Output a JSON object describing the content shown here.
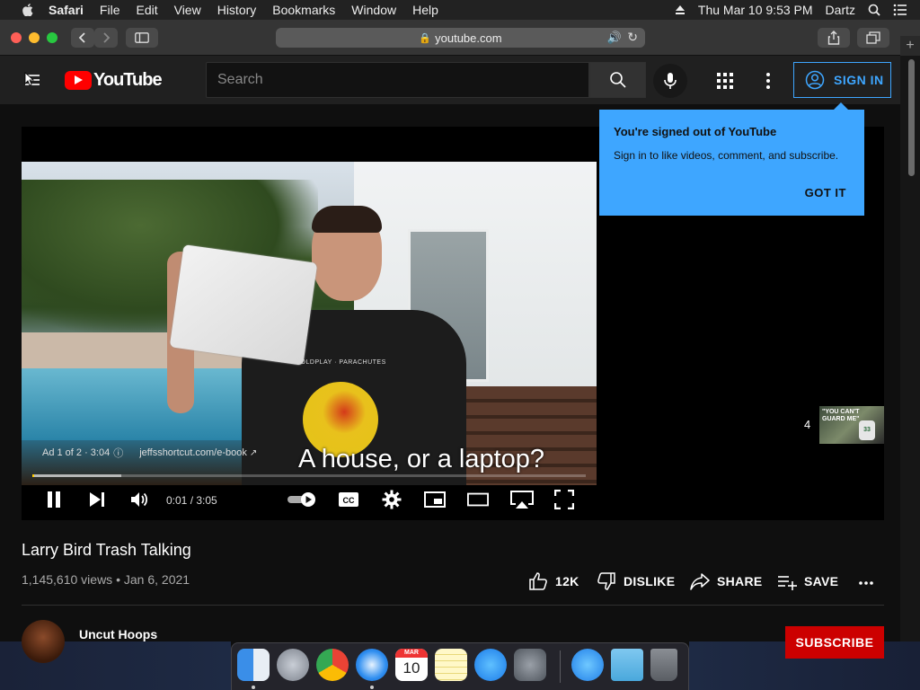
{
  "menubar": {
    "app": "Safari",
    "items": [
      "File",
      "Edit",
      "View",
      "History",
      "Bookmarks",
      "Window",
      "Help"
    ],
    "datetime": "Thu Mar 10  9:53 PM",
    "user": "Dartz"
  },
  "browser": {
    "url": "youtube.com"
  },
  "youtube": {
    "logo_text": "YouTube",
    "search_placeholder": "Search",
    "sign_in_label": "SIGN IN"
  },
  "tooltip": {
    "title": "You're signed out of YouTube",
    "body": "Sign in to like videos, comment, and subscribe.",
    "button": "GOT IT"
  },
  "player": {
    "ad_label": "Ad 1 of 2 · 3:04",
    "ad_link": "jeffsshortcut.com/e-book",
    "subtitle": "A house, or a laptop?",
    "time": "0:01 / 3:05",
    "progress_fraction": 0.003,
    "loaded_fraction": 0.16,
    "shirt_text": "COLDPLAY · PARACHUTES",
    "upnext_count": "4",
    "upnext_thumb_text": "\"YOU CAN'T GUARD ME\"",
    "upnext_jersey": "33"
  },
  "video": {
    "title": "Larry Bird Trash Talking",
    "views": "1,145,610 views",
    "date": "Jan 6, 2021",
    "likes": "12K",
    "dislike_label": "DISLIKE",
    "share_label": "SHARE",
    "save_label": "SAVE"
  },
  "channel": {
    "name": "Uncut Hoops",
    "subscribe_label": "SUBSCRIBE"
  },
  "dock": {
    "calendar_month": "MAR",
    "calendar_day": "10"
  },
  "colors": {
    "accent_blue": "#3ea6ff",
    "youtube_red": "#ff0000",
    "subscribe_red": "#cc0000",
    "progress_yellow": "#ffcc00"
  }
}
